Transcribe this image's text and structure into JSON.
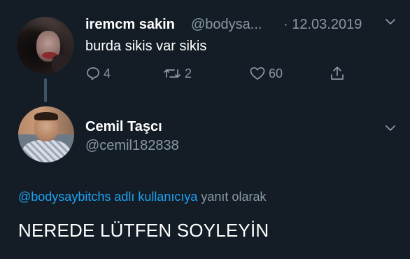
{
  "parent_tweet": {
    "display_name": "iremcm sakin",
    "handle": "@bodysa...",
    "date": "· 12.03.2019",
    "text": "burda sikis var sikis",
    "reply_count": "4",
    "retweet_count": "2",
    "like_count": "60",
    "icons": [
      "chevron-down-icon",
      "reply-icon",
      "retweet-icon",
      "heart-icon",
      "share-icon"
    ]
  },
  "reply_tweet": {
    "display_name": "Cemil Taşcı",
    "handle": "@cemil182838",
    "replying_to_mention": "@bodysaybitchs adlı kullanıcıya",
    "replying_to_suffix": " yanıt olarak",
    "text": "NEREDE LÜTFEN SOYLEYİN"
  },
  "colors": {
    "background": "#141d26",
    "primary_text": "#ffffff",
    "secondary_text": "#8899a6",
    "link": "#1da1f2",
    "thread_line": "#3d5466"
  }
}
